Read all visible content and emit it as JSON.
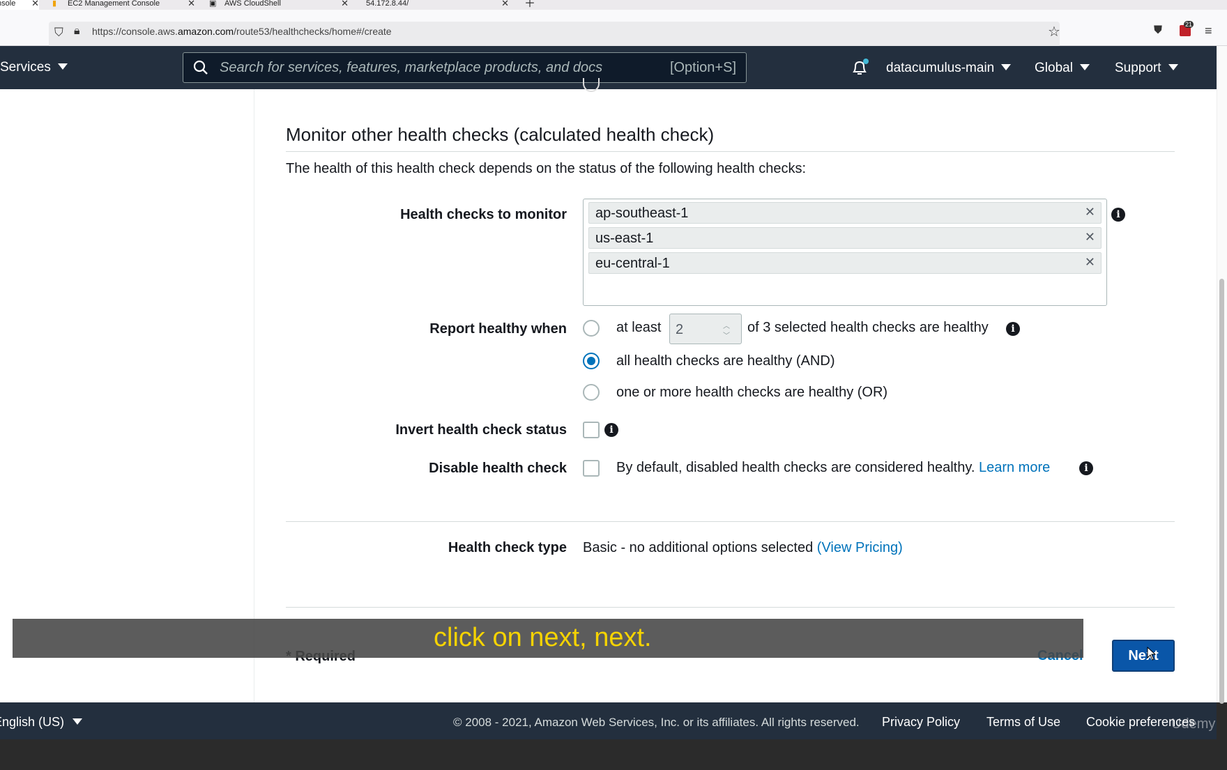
{
  "browser": {
    "tabs": [
      {
        "label": "Console",
        "active": true
      },
      {
        "label": "EC2 Management Console"
      },
      {
        "label": "AWS CloudShell"
      },
      {
        "label": "54.172.8.44/"
      }
    ],
    "url_prefix": "https://console.aws.",
    "url_domain": "amazon.com",
    "url_path": "/route53/healthchecks/home#/create",
    "ext_badge": "21"
  },
  "nav": {
    "services": "Services",
    "search_placeholder": "Search for services, features, marketplace products, and docs",
    "search_shortcut": "[Option+S]",
    "account": "datacumulus-main",
    "region": "Global",
    "support": "Support"
  },
  "section": {
    "title": "Monitor other health checks (calculated health check)",
    "description": "The health of this health check depends on the status of the following health checks:"
  },
  "form": {
    "monitor_label": "Health checks to monitor",
    "monitored": [
      "ap-southeast-1",
      "us-east-1",
      "eu-central-1"
    ],
    "report_label": "Report healthy when",
    "at_least": "at least",
    "threshold_value": "2",
    "threshold_suffix": "of 3 selected health checks are healthy",
    "option_and": "all health checks are healthy (AND)",
    "option_or": "one or more health checks are healthy (OR)",
    "selected_option": "and",
    "invert_label": "Invert health check status",
    "disable_label": "Disable health check",
    "disable_desc": "By default, disabled health checks are considered healthy.",
    "learn_more": "Learn more",
    "type_label": "Health check type",
    "type_value": "Basic - no additional options selected",
    "view_pricing": "(View Pricing)"
  },
  "actions": {
    "required": "* Required",
    "cancel": "Cancel",
    "next": "Next"
  },
  "caption": "click on next, next.",
  "footer": {
    "language": "English (US)",
    "copyright": "© 2008 - 2021, Amazon Web Services, Inc. or its affiliates. All rights reserved.",
    "privacy": "Privacy Policy",
    "terms": "Terms of Use",
    "cookies": "Cookie preferences"
  },
  "watermark": "Udemy",
  "colors": {
    "nav_bg": "#232f3e",
    "link": "#0073bb",
    "primary_button": "#0a56a8",
    "caption_text": "#f5d300"
  }
}
